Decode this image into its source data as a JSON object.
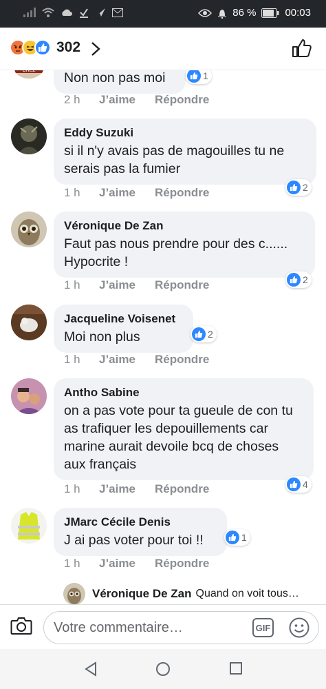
{
  "status_bar": {
    "battery": "86 %",
    "time": "00:03"
  },
  "header": {
    "reaction_count": "302",
    "icons": [
      "angry-icon",
      "haha-icon",
      "like-icon"
    ]
  },
  "colors": {
    "accent": "#2d88ff",
    "bubble": "#f0f2f5",
    "muted": "#8a8d91",
    "status_bg": "#23272b"
  },
  "actions": {
    "like": "J’aime",
    "reply": "Répondre"
  },
  "comments": [
    {
      "name": "",
      "text": "Non non pas moi",
      "time": "2 h",
      "reactions": "1"
    },
    {
      "name": "Eddy Suzuki",
      "text": "si il n'y avais pas de magouilles tu ne serais pas la fumier",
      "time": "1 h",
      "reactions": "2"
    },
    {
      "name": "Véronique De Zan",
      "text": "Faut pas nous prendre pour des c...... Hypocrite !",
      "time": "1 h",
      "reactions": "2"
    },
    {
      "name": "Jacqueline Voisenet",
      "text": "Moi non plus",
      "time": "1 h",
      "reactions": "2"
    },
    {
      "name": "Antho Sabine",
      "text": "on a pas vote pour ta gueule de con tu as trafiquer les depouillements car marine aurait devoile bcq de choses aux français",
      "time": "1 h",
      "reactions": "4"
    },
    {
      "name": "JMarc Cécile Denis",
      "text": "J ai pas voter pour toi !!",
      "time": "1 h",
      "reactions": "1"
    }
  ],
  "reply_preview": {
    "name": "Véronique De Zan",
    "text": "Quand on voit tous…"
  },
  "composer": {
    "placeholder": "Votre commentaire…",
    "gif": "GIF"
  }
}
